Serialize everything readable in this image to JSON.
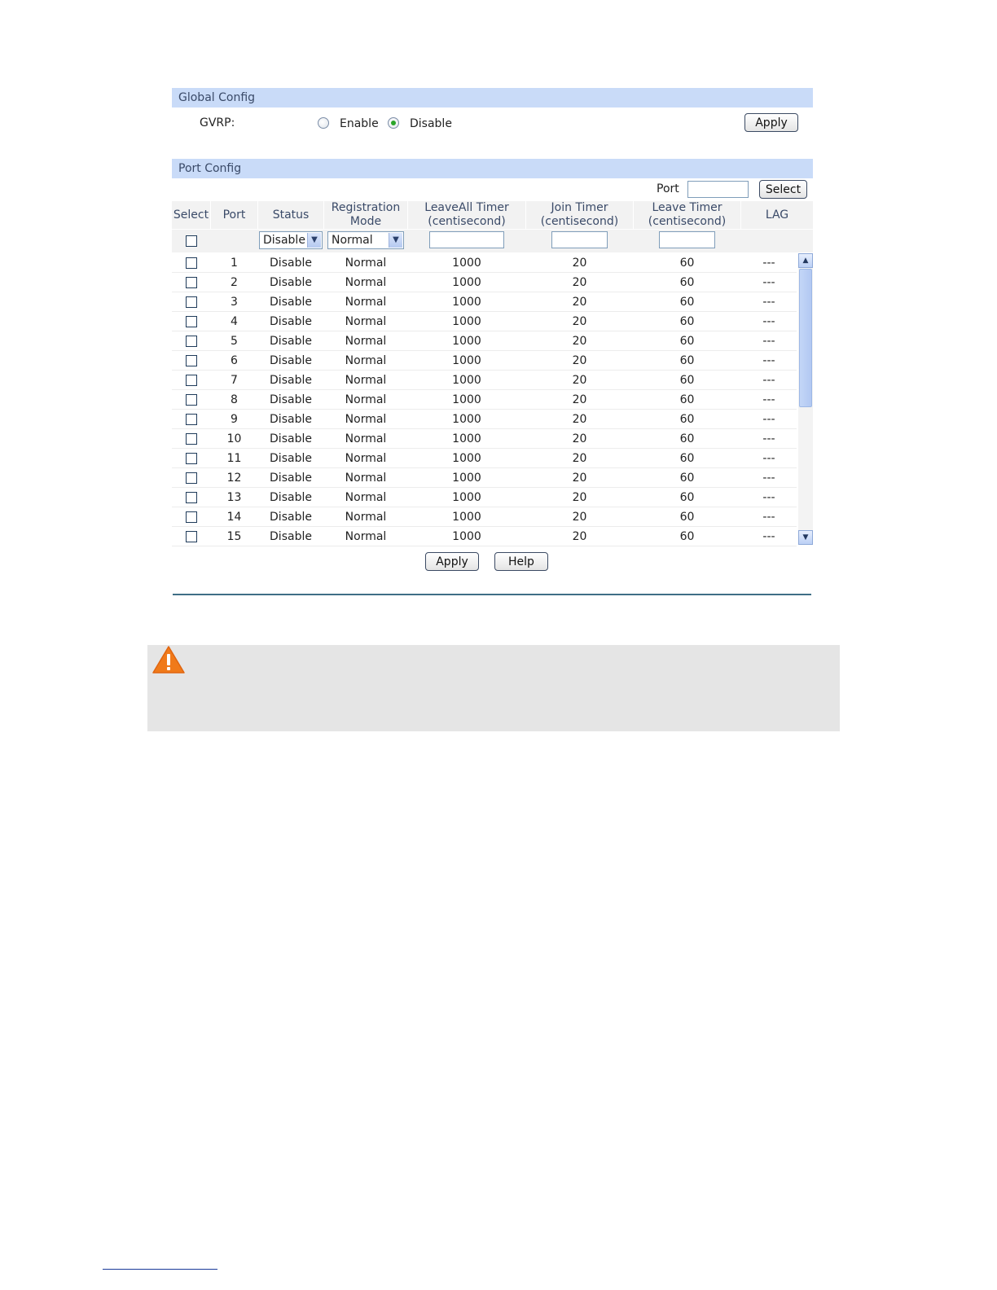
{
  "global_config": {
    "title": "Global Config",
    "gvrp_label": "GVRP:",
    "enable_label": "Enable",
    "disable_label": "Disable",
    "selected": "Disable",
    "apply_label": "Apply"
  },
  "port_config": {
    "title": "Port Config",
    "port_filter_label": "Port",
    "port_filter_value": "",
    "select_button_label": "Select",
    "columns": {
      "select": "Select",
      "port": "Port",
      "status": "Status",
      "registration_line1": "Registration",
      "registration_line2": "Mode",
      "leaveall_line1": "LeaveAll Timer",
      "leaveall_line2": "(centisecond)",
      "join_line1": "Join Timer",
      "join_line2": "(centisecond)",
      "leave_line1": "Leave Timer",
      "leave_line2": "(centisecond)",
      "lag": "LAG"
    },
    "bulk_edit": {
      "status_selected": "Disable",
      "registration_selected": "Normal",
      "leaveall_value": "",
      "join_value": "",
      "leave_value": ""
    },
    "rows": [
      {
        "port": "1",
        "status": "Disable",
        "registration": "Normal",
        "leaveall": "1000",
        "join": "20",
        "leave": "60",
        "lag": "---"
      },
      {
        "port": "2",
        "status": "Disable",
        "registration": "Normal",
        "leaveall": "1000",
        "join": "20",
        "leave": "60",
        "lag": "---"
      },
      {
        "port": "3",
        "status": "Disable",
        "registration": "Normal",
        "leaveall": "1000",
        "join": "20",
        "leave": "60",
        "lag": "---"
      },
      {
        "port": "4",
        "status": "Disable",
        "registration": "Normal",
        "leaveall": "1000",
        "join": "20",
        "leave": "60",
        "lag": "---"
      },
      {
        "port": "5",
        "status": "Disable",
        "registration": "Normal",
        "leaveall": "1000",
        "join": "20",
        "leave": "60",
        "lag": "---"
      },
      {
        "port": "6",
        "status": "Disable",
        "registration": "Normal",
        "leaveall": "1000",
        "join": "20",
        "leave": "60",
        "lag": "---"
      },
      {
        "port": "7",
        "status": "Disable",
        "registration": "Normal",
        "leaveall": "1000",
        "join": "20",
        "leave": "60",
        "lag": "---"
      },
      {
        "port": "8",
        "status": "Disable",
        "registration": "Normal",
        "leaveall": "1000",
        "join": "20",
        "leave": "60",
        "lag": "---"
      },
      {
        "port": "9",
        "status": "Disable",
        "registration": "Normal",
        "leaveall": "1000",
        "join": "20",
        "leave": "60",
        "lag": "---"
      },
      {
        "port": "10",
        "status": "Disable",
        "registration": "Normal",
        "leaveall": "1000",
        "join": "20",
        "leave": "60",
        "lag": "---"
      },
      {
        "port": "11",
        "status": "Disable",
        "registration": "Normal",
        "leaveall": "1000",
        "join": "20",
        "leave": "60",
        "lag": "---"
      },
      {
        "port": "12",
        "status": "Disable",
        "registration": "Normal",
        "leaveall": "1000",
        "join": "20",
        "leave": "60",
        "lag": "---"
      },
      {
        "port": "13",
        "status": "Disable",
        "registration": "Normal",
        "leaveall": "1000",
        "join": "20",
        "leave": "60",
        "lag": "---"
      },
      {
        "port": "14",
        "status": "Disable",
        "registration": "Normal",
        "leaveall": "1000",
        "join": "20",
        "leave": "60",
        "lag": "---"
      },
      {
        "port": "15",
        "status": "Disable",
        "registration": "Normal",
        "leaveall": "1000",
        "join": "20",
        "leave": "60",
        "lag": "---"
      }
    ],
    "apply_label": "Apply",
    "help_label": "Help"
  },
  "icons": {
    "warning": "warning-icon",
    "scroll_up": "chevron-up-icon",
    "scroll_down": "chevron-down-icon",
    "dropdown": "chevron-down-icon"
  },
  "colors": {
    "header_band": "#c9dbf8",
    "header_text": "#3a4a68",
    "warning": "#f07a1a"
  }
}
